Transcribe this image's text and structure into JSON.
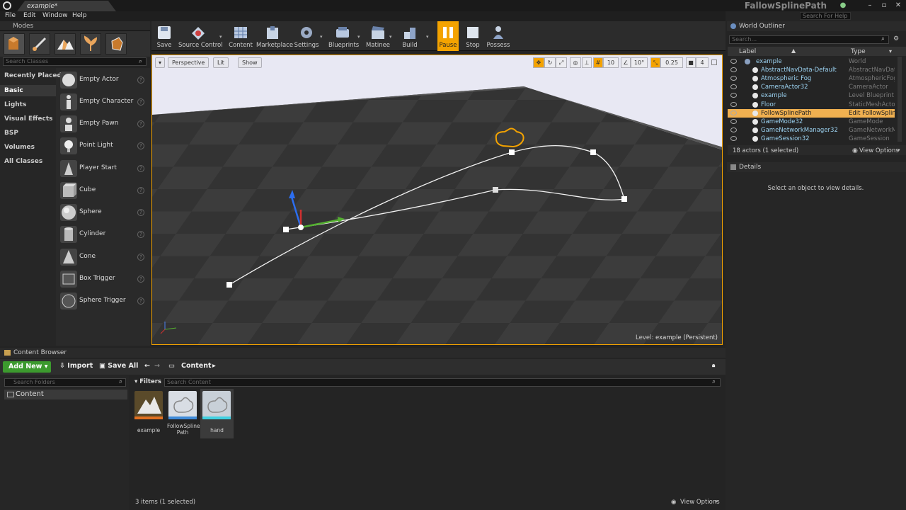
{
  "titlebar": {
    "doc_tab": "example*",
    "window_title": "FallowSplinePath",
    "search_placeholder": "Search For Help",
    "min_icon": "minimize-icon",
    "max_icon": "maximize-icon",
    "close_icon": "close-icon"
  },
  "menu": [
    "File",
    "Edit",
    "Window",
    "Help"
  ],
  "modes": {
    "tab_label": "Modes",
    "search_placeholder": "Search Classes",
    "categories": [
      "Recently Placed",
      "Basic",
      "Lights",
      "Visual Effects",
      "BSP",
      "Volumes",
      "All Classes"
    ],
    "selected_category": "Basic",
    "items": [
      "Empty Actor",
      "Empty Character",
      "Empty Pawn",
      "Point Light",
      "Player Start",
      "Cube",
      "Sphere",
      "Cylinder",
      "Cone",
      "Box Trigger",
      "Sphere Trigger"
    ]
  },
  "toolbar": {
    "buttons": [
      "Save",
      "Source Control",
      "Content",
      "Marketplace",
      "Settings",
      "Blueprints",
      "Matinee",
      "Build",
      "Pause",
      "Stop",
      "Possess"
    ],
    "active": "Pause"
  },
  "viewport": {
    "perspective": "Perspective",
    "lit": "Lit",
    "show": "Show",
    "grid_snap": "10",
    "rot_snap": "10°",
    "scale_snap": "0.25",
    "camera_speed": "4",
    "level_prefix": "Level:",
    "level_name": "example (Persistent)"
  },
  "world_outliner": {
    "tab_label": "World Outliner",
    "search_placeholder": "Search...",
    "col_label": "Label",
    "col_type": "Type",
    "rows": [
      {
        "label": "example",
        "type": "World"
      },
      {
        "label": "AbstractNavData-Default",
        "type": "AbstractNavData"
      },
      {
        "label": "Atmospheric Fog",
        "type": "AtmosphericFog"
      },
      {
        "label": "CameraActor32",
        "type": "CameraActor"
      },
      {
        "label": "example",
        "type": "Level Blueprint"
      },
      {
        "label": "Floor",
        "type": "StaticMeshActor"
      },
      {
        "label": "FollowSplinePath",
        "type": "Edit FollowSpline"
      },
      {
        "label": "GameMode32",
        "type": "GameMode"
      },
      {
        "label": "GameNetworkManager32",
        "type": "GameNetworkMan"
      },
      {
        "label": "GameSession32",
        "type": "GameSession"
      }
    ],
    "selected_index": 6,
    "footer_count": "18 actors (1 selected)",
    "view_options": "View Options"
  },
  "details": {
    "tab_label": "Details",
    "empty_message": "Select an object to view details."
  },
  "content_browser": {
    "tab_label": "Content Browser",
    "add_new": "Add New",
    "import": "Import",
    "save_all": "Save All",
    "path": "Content",
    "folder_search_placeholder": "Search Folders",
    "folder": "Content",
    "filters": "Filters",
    "content_search_placeholder": "Search Content",
    "assets": [
      {
        "name": "example",
        "icon": "level-map-icon"
      },
      {
        "name": "FollowSpline Path",
        "icon": "blueprint-hand-icon"
      },
      {
        "name": "hand",
        "icon": "static-mesh-hand-icon"
      }
    ],
    "status": "3 items (1 selected)",
    "view_options": "View Options"
  },
  "colors": {
    "accent": "#f4a300",
    "selection": "#f0b050",
    "add_new": "#3c9a2e",
    "outliner_text": "#9cd3f2"
  }
}
